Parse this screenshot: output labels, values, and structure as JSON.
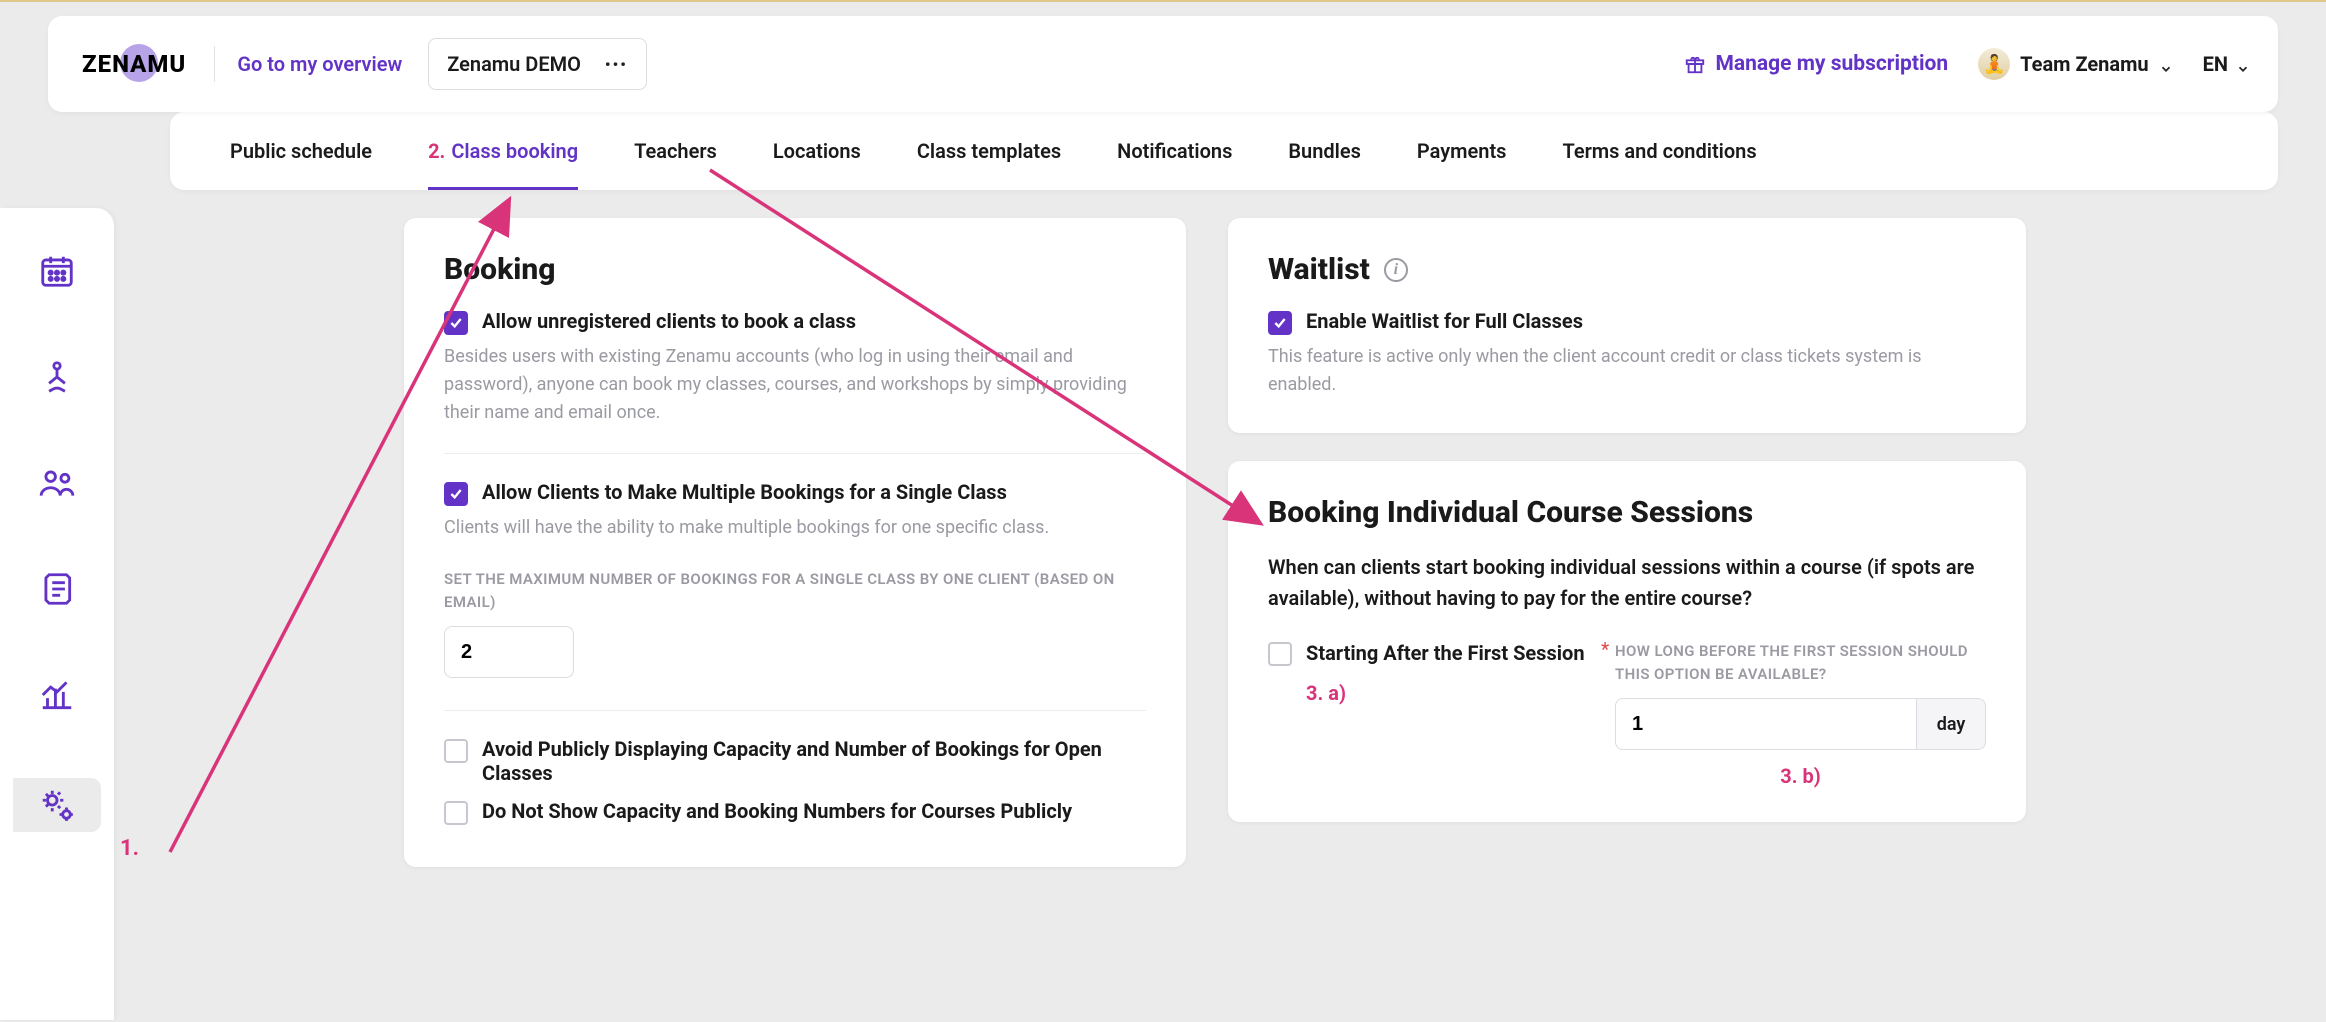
{
  "header": {
    "logo_text": "ZENAMU",
    "overview_link": "Go to my overview",
    "demo_label": "Zenamu DEMO",
    "subscription_label": "Manage my subscription",
    "team_label": "Team Zenamu",
    "lang_label": "EN"
  },
  "tabs": {
    "items": [
      {
        "label": "Public schedule",
        "active": false
      },
      {
        "label": "Class booking",
        "active": true,
        "step": "2."
      },
      {
        "label": "Teachers",
        "active": false
      },
      {
        "label": "Locations",
        "active": false
      },
      {
        "label": "Class templates",
        "active": false
      },
      {
        "label": "Notifications",
        "active": false
      },
      {
        "label": "Bundles",
        "active": false
      },
      {
        "label": "Payments",
        "active": false
      },
      {
        "label": "Terms and conditions",
        "active": false
      }
    ]
  },
  "annotations": {
    "step1": "1.",
    "step3a": "3. a)",
    "step3b": "3. b)"
  },
  "booking": {
    "title": "Booking",
    "allow_unreg": {
      "label": "Allow unregistered clients to book a class",
      "checked": true,
      "desc": "Besides users with existing Zenamu accounts (who log in using their email and password), anyone can book my classes, courses, and workshops by simply providing their name and email once."
    },
    "allow_multiple": {
      "label": "Allow Clients to Make Multiple Bookings for a Single Class",
      "checked": true,
      "desc": "Clients will have the ability to make multiple bookings for one specific class."
    },
    "max_label": "SET THE MAXIMUM NUMBER OF BOOKINGS FOR A SINGLE CLASS BY ONE CLIENT (BASED ON EMAIL)",
    "max_value": "2",
    "avoid_capacity": {
      "label": "Avoid Publicly Displaying Capacity and Number of Bookings for Open Classes",
      "checked": false
    },
    "avoid_course_capacity": {
      "label": "Do Not Show Capacity and Booking Numbers for Courses Publicly",
      "checked": false
    }
  },
  "waitlist": {
    "title": "Waitlist",
    "enable": {
      "label": "Enable Waitlist for Full Classes",
      "checked": true
    },
    "desc": "This feature is active only when the client account credit or class tickets system is enabled."
  },
  "course_sessions": {
    "title": "Booking Individual Course Sessions",
    "desc": "When can clients start booking individual sessions within a course (if spots are available), without having to pay for the entire course?",
    "start_after": {
      "label": "Starting After the First Session",
      "checked": false
    },
    "field_label": "HOW LONG BEFORE THE FIRST SESSION SHOULD THIS OPTION BE AVAILABLE?",
    "value": "1",
    "unit": "day"
  }
}
